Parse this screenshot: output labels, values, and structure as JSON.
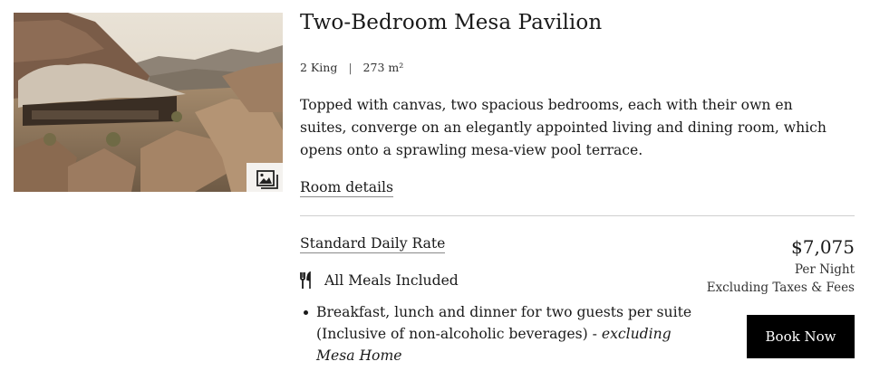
{
  "room": {
    "title": "Two-Bedroom Mesa Pavilion",
    "beds": "2 King",
    "spec_separator": "|",
    "area": "273 m²",
    "description": "Topped with canvas, two spacious bedrooms, each with their own en suites, converge on an elegantly appointed living and dining room, which opens onto a sprawling mesa-view pool terrace.",
    "details_link": "Room details",
    "photo_icon": "gallery-icon"
  },
  "rate": {
    "name": "Standard Daily Rate",
    "meals_icon": "fork-knife-icon",
    "meals_label": "All Meals Included",
    "meals_detail": "Breakfast, lunch and dinner for two guests per suite (Inclusive of non-alcoholic beverages) - ",
    "meals_detail_italic": "excluding Mesa Home",
    "price": "$7,075",
    "per_night": "Per Night",
    "taxes_note": "Excluding Taxes & Fees",
    "book_button": "Book Now"
  },
  "colors": {
    "button_bg": "#000000",
    "divider": "#cfcfcf"
  }
}
